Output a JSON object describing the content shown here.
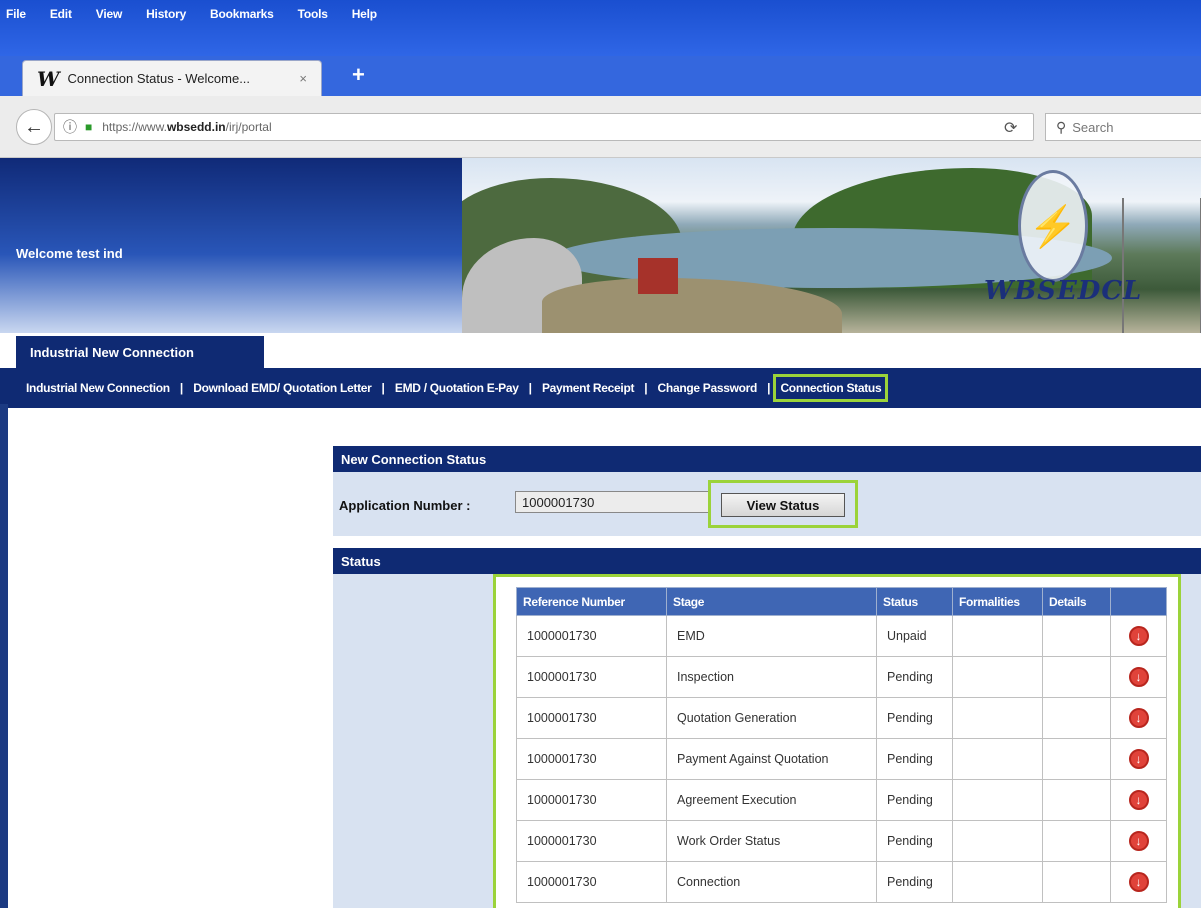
{
  "browser": {
    "menu": [
      "File",
      "Edit",
      "View",
      "History",
      "Bookmarks",
      "Tools",
      "Help"
    ],
    "tab_title": "Connection Status - Welcome...",
    "tab_close": "×",
    "new_tab": "+",
    "url_prefix": "https://www.",
    "url_domain": "wbsedd.in",
    "url_path": "/irj/portal",
    "search_placeholder": "Search"
  },
  "banner": {
    "welcome": "Welcome test ind",
    "brand": "WBSEDCL"
  },
  "portal": {
    "active_tab": "Industrial New Connection",
    "nav": [
      "Industrial New Connection",
      "Download EMD/ Quotation Letter",
      "EMD / Quotation E-Pay",
      "Payment Receipt",
      "Change Password",
      "Connection Status"
    ],
    "separator": "|"
  },
  "connection_status": {
    "title": "New Connection Status",
    "app_label": "Application Number :",
    "app_value": "1000001730",
    "view_button": "View Status"
  },
  "status": {
    "title": "Status",
    "columns": [
      "Reference Number",
      "Stage",
      "Status",
      "Formalities",
      "Details",
      ""
    ],
    "rows": [
      {
        "ref": "1000001730",
        "stage": "EMD",
        "status": "Unpaid"
      },
      {
        "ref": "1000001730",
        "stage": "Inspection",
        "status": "Pending"
      },
      {
        "ref": "1000001730",
        "stage": "Quotation Generation",
        "status": "Pending"
      },
      {
        "ref": "1000001730",
        "stage": "Payment Against Quotation",
        "status": "Pending"
      },
      {
        "ref": "1000001730",
        "stage": "Agreement Execution",
        "status": "Pending"
      },
      {
        "ref": "1000001730",
        "stage": "Work Order Status",
        "status": "Pending"
      },
      {
        "ref": "1000001730",
        "stage": "Connection",
        "status": "Pending"
      }
    ]
  },
  "colors": {
    "portal_navy": "#0f2a73",
    "table_header": "#3f66b4",
    "highlight": "#9bd33a",
    "panel_bg": "#d8e2f1"
  }
}
